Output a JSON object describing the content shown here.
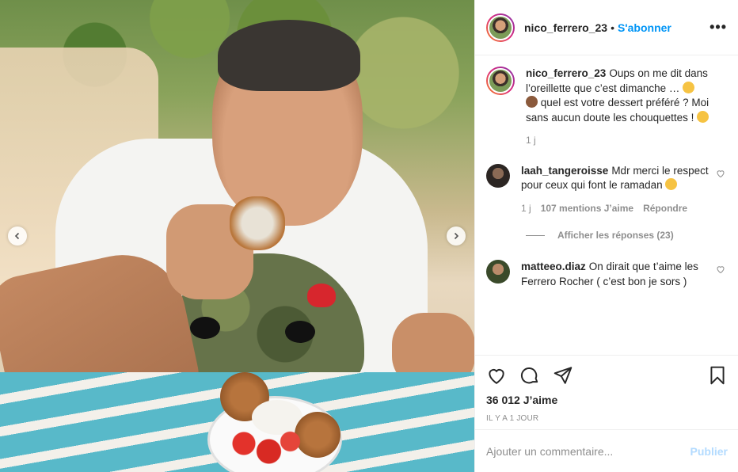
{
  "post": {
    "username": "nico_ferrero_23",
    "follow_label": "S'abonner",
    "separator": "•",
    "more_label": "•••"
  },
  "caption": {
    "username": "nico_ferrero_23",
    "line1": "Oups on me dit dans l’oreillette que c’est dimanche …",
    "line2": "quel est votre dessert préféré ? Moi sans aucun doute les chouquettes !",
    "time": "1 j"
  },
  "comments": [
    {
      "username": "laah_tangeroisse",
      "text": "Mdr merci le respect pour ceux qui font le ramadan",
      "time": "1 j",
      "likes": "107 mentions J’aime",
      "reply": "Répondre",
      "view_replies": "Afficher les réponses (23)"
    },
    {
      "username": "matteeo.diaz",
      "text": "On dirait que t’aime les Ferrero Rocher ( c’est bon je sors )"
    }
  ],
  "stats": {
    "likes": "36 012 J’aime",
    "date": "IL Y A 1 JOUR"
  },
  "add_comment": {
    "placeholder": "Ajouter un commentaire...",
    "publish": "Publier"
  },
  "icons": {
    "heart": "heart-icon",
    "comment": "comment-icon",
    "share": "share-icon",
    "save": "bookmark-icon",
    "prev": "chevron-left-icon",
    "next": "chevron-right-icon"
  }
}
